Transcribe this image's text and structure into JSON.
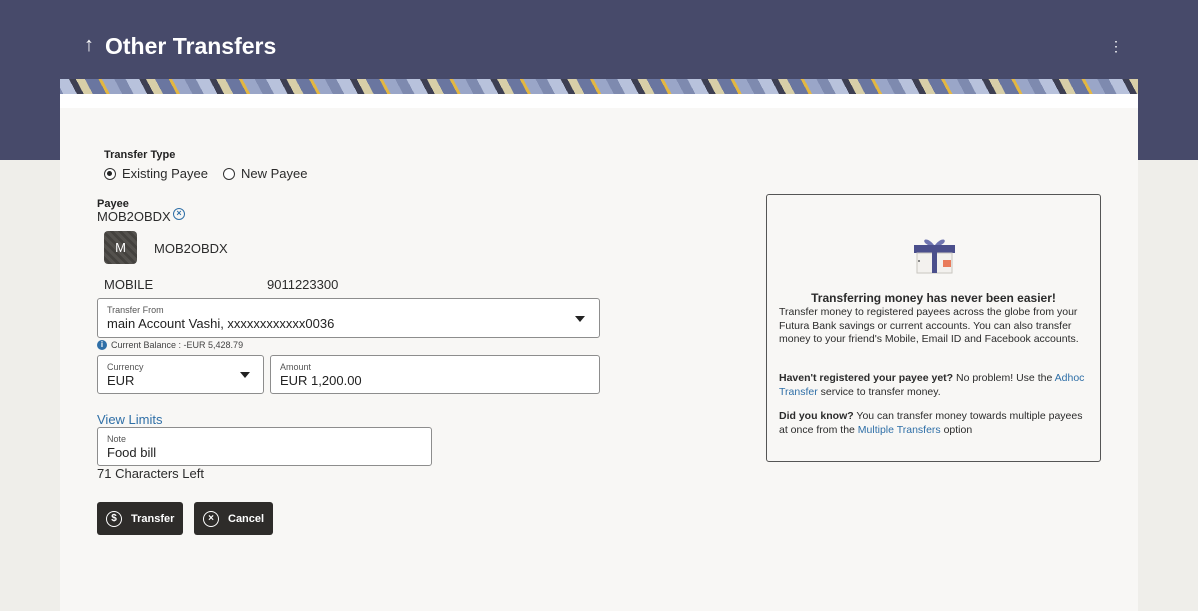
{
  "header": {
    "title": "Other Transfers",
    "back_icon": "↑",
    "menu_icon": "⋮"
  },
  "form": {
    "transfer_type_label": "Transfer Type",
    "transfer_type_options": [
      "Existing Payee",
      "New Payee"
    ],
    "transfer_type_selected": "Existing Payee",
    "payee_label": "Payee",
    "payee_value": "MOB2OBDX",
    "payee_avatar_letter": "M",
    "payee_name": "MOB2OBDX",
    "payee_type": "MOBILE",
    "payee_number": "9011223300",
    "transfer_from_label": "Transfer From",
    "transfer_from_value": "main Account Vashi, xxxxxxxxxxxx0036",
    "current_balance": "Current Balance : -EUR 5,428.79",
    "currency_label": "Currency",
    "currency_value": "EUR",
    "amount_label": "Amount",
    "amount_value": "EUR 1,200.00",
    "view_limits": "View Limits",
    "note_label": "Note",
    "note_value": "Food bill",
    "chars_left": "71 Characters Left",
    "transfer_button": "Transfer",
    "cancel_button": "Cancel"
  },
  "panel": {
    "heading": "Transferring money has never been easier!",
    "body1": "Transfer money to registered payees across the globe from your Futura Bank savings or current accounts. You can also transfer money to your friend's Mobile, Email ID and Facebook accounts.",
    "q1_bold": "Haven't registered your payee yet?",
    "q1_text": " No problem! Use the ",
    "q1_link": "Adhoc Transfer",
    "q1_end": " service to transfer money.",
    "q2_bold": "Did you know?",
    "q2_text": " You can transfer money towards multiple payees at once from the ",
    "q2_link": "Multiple Transfers",
    "q2_end": " option"
  },
  "colors": {
    "header_bg": "#474a6a",
    "link": "#2f6fa7",
    "button_bg": "#2e2c2a"
  }
}
